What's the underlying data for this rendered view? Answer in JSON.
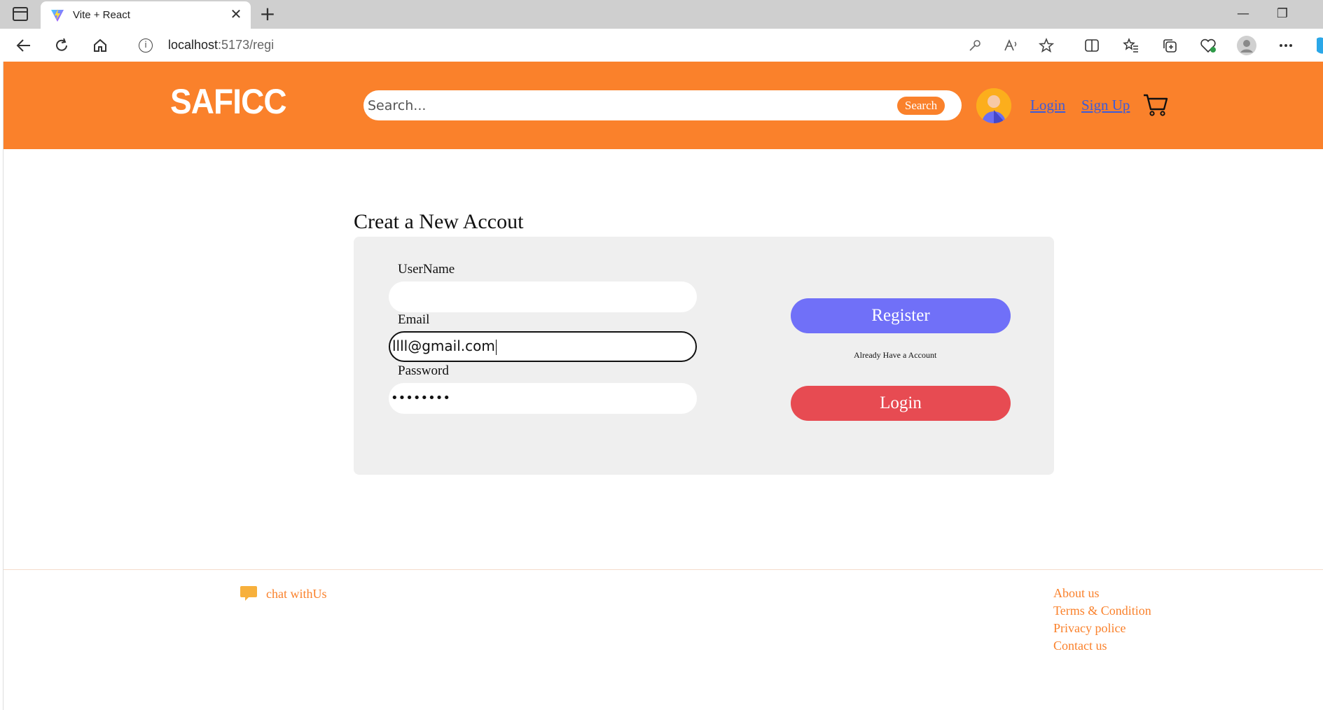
{
  "browser": {
    "tab_title": "Vite + React",
    "url_host": "localhost",
    "url_rest": ":5173/regi"
  },
  "header": {
    "logo": "SAFICC",
    "search_placeholder": "Search...",
    "search_button": "Search",
    "login_link": "Login",
    "signup_link": "Sign Up",
    "brand_color": "#fa812b"
  },
  "form": {
    "title": "Creat a New Accout",
    "username_label": "UserName",
    "username_value": "",
    "email_label": "Email",
    "email_value": "llll@gmail.com",
    "password_label": "Password",
    "password_value": "••••••••",
    "register_button": "Register",
    "already_text": "Already Have a Account",
    "login_button": "Login",
    "register_color": "#7070f8",
    "login_color": "#e74b52"
  },
  "footer": {
    "chat_label": "chat withUs",
    "links": [
      "About us",
      "Terms & Condition",
      "Privacy police",
      "Contact us"
    ]
  }
}
